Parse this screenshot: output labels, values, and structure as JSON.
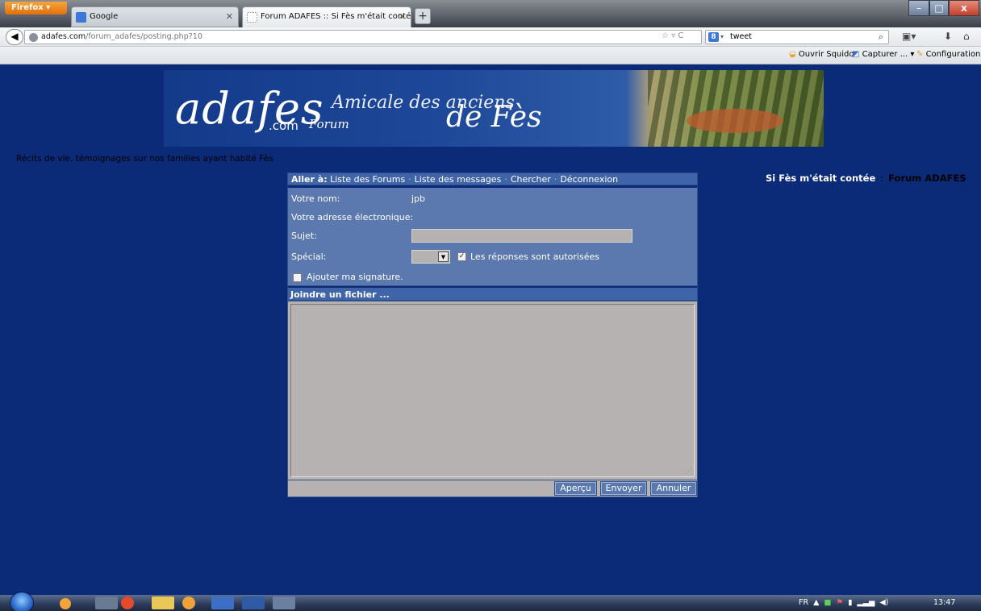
{
  "browser": {
    "menu_button": "Firefox",
    "tabs": [
      {
        "label": "Google",
        "icon": "google-icon"
      },
      {
        "label": "Forum ADAFES :: Si Fès m'était contée",
        "icon": "page-icon"
      }
    ],
    "new_tab": "+",
    "url_host": "adafes.com",
    "url_path": "/forum_adafes/posting.php?10",
    "search_value": "tweet",
    "bookmarks": [
      "Ouvrir Squido",
      "Capturer ...",
      "Configuration"
    ],
    "window_buttons": {
      "minimize": "–",
      "maximize": "□",
      "close": "x"
    }
  },
  "page": {
    "banner": {
      "logo": "adafes",
      "dotcom": ".com",
      "forum": "Forum",
      "tagline": "Amicale des anciens",
      "fes": "de Fès"
    },
    "subtitle": "Récits de vie, témoignages sur nos familles ayant habité Fès",
    "right_title": {
      "site": "Si Fès m'était contée",
      "separator": ":",
      "forum": "Forum ADAFES"
    },
    "menu": {
      "label": "Aller à:",
      "links": [
        "Liste des Forums",
        "Liste des messages",
        "Chercher",
        "Déconnexion"
      ]
    },
    "form": {
      "name_label": "Votre nom:",
      "name_value": "jpb",
      "email_label": "Votre adresse électronique:",
      "subject_label": "Sujet:",
      "subject_value": "",
      "special_label": "Spécial:",
      "special_value": "",
      "replies_label": "Les réponses sont autorisées",
      "replies_checked": true,
      "signature_label": "Ajouter ma signature.",
      "signature_checked": false,
      "attach_label": "Joindre un fichier ...",
      "message_value": "",
      "buttons": {
        "preview": "Aperçu",
        "send": "Envoyer",
        "cancel": "Annuler"
      }
    }
  },
  "taskbar": {
    "language": "FR",
    "clock": "13:47"
  },
  "colors": {
    "page_bg": "#0b2a78",
    "panel": "#5b79af",
    "menu_bar": "#3f64a7",
    "input_bg": "#b7b2b2"
  }
}
